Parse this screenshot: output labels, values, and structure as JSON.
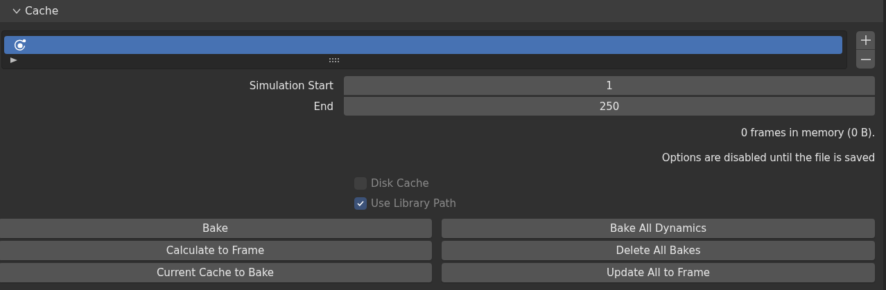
{
  "panel": {
    "title": "Cache",
    "expanded": true
  },
  "cache_list": {
    "items": [
      {
        "selected": true
      }
    ]
  },
  "fields": [
    {
      "label": "Simulation Start",
      "value": "1"
    },
    {
      "label": "End",
      "value": "250"
    }
  ],
  "info": [
    "0 frames in memory (0 B).",
    "Options are disabled until the file is saved"
  ],
  "checkboxes": [
    {
      "label": "Disk Cache",
      "checked": false,
      "disabled": true
    },
    {
      "label": "Use Library Path",
      "checked": true,
      "disabled": true
    }
  ],
  "buttons": [
    [
      "Bake",
      "Bake All Dynamics"
    ],
    [
      "Calculate to Frame",
      "Delete All Bakes"
    ],
    [
      "Current Cache to Bake",
      "Update All to Frame"
    ]
  ]
}
